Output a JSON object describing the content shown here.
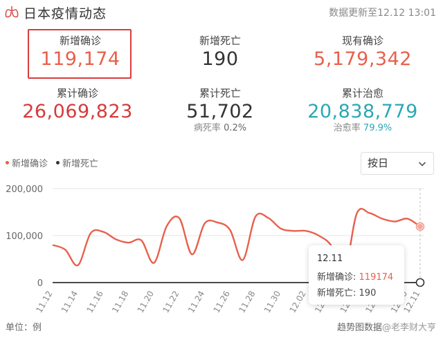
{
  "header": {
    "title": "日本疫情动态",
    "chevron": "›",
    "update_time": "数据更新至12.12 13:01"
  },
  "stats": {
    "new_confirmed": {
      "label": "新增确诊",
      "value": "119,174"
    },
    "new_deaths": {
      "label": "新增死亡",
      "value": "190"
    },
    "current_confirmed": {
      "label": "现有确诊",
      "value": "5,179,342"
    },
    "total_confirmed": {
      "label": "累计确诊",
      "value": "26,069,823"
    },
    "total_deaths": {
      "label": "累计死亡",
      "value": "51,702",
      "sub_label": "病死率",
      "sub_value": "0.2%"
    },
    "total_recovered": {
      "label": "累计治愈",
      "value": "20,838,779",
      "sub_label": "治愈率",
      "sub_value": "79.9%"
    }
  },
  "legend": {
    "confirmed": "新增确诊",
    "deaths": "新增死亡"
  },
  "select": {
    "value": "按日"
  },
  "colors": {
    "confirmed": "#e8604c",
    "deaths": "#333333",
    "highlight": "#d93b3b"
  },
  "chart_data": {
    "type": "line",
    "x": [
      "11.12",
      "11.13",
      "11.14",
      "11.15",
      "11.16",
      "11.17",
      "11.18",
      "11.19",
      "11.20",
      "11.21",
      "11.22",
      "11.23",
      "11.24",
      "11.25",
      "11.26",
      "11.27",
      "11.28",
      "11.29",
      "11.30",
      "12.01",
      "12.02",
      "12.03",
      "12.04",
      "12.05",
      "12.06",
      "12.07",
      "12.08",
      "12.09",
      "12.10",
      "12.11"
    ],
    "x_ticks": [
      "11.12",
      "11.14",
      "11.16",
      "11.18",
      "11.20",
      "11.22",
      "11.24",
      "11.26",
      "11.28",
      "11.30",
      "12.02",
      "12.04",
      "12.06",
      "12.08",
      "12.10",
      "12.11"
    ],
    "series": [
      {
        "name": "新增确诊",
        "values": [
          80000,
          70000,
          37000,
          105000,
          108000,
          92000,
          85000,
          90000,
          42000,
          120000,
          137000,
          60000,
          126000,
          128000,
          112000,
          48000,
          140000,
          138000,
          115000,
          110000,
          110000,
          100000,
          78000,
          20000,
          147000,
          148000,
          136000,
          130000,
          136000,
          119174
        ]
      },
      {
        "name": "新增死亡",
        "values": [
          0,
          0,
          0,
          0,
          0,
          0,
          0,
          0,
          0,
          0,
          0,
          0,
          0,
          0,
          0,
          0,
          0,
          0,
          0,
          0,
          0,
          0,
          0,
          0,
          0,
          0,
          0,
          0,
          0,
          190
        ]
      }
    ],
    "yticks": [
      "0",
      "100,000",
      "200,000"
    ],
    "ylim": [
      0,
      200000
    ]
  },
  "tooltip": {
    "date": "12.11",
    "confirmed_label": "新增确诊:",
    "confirmed_value": "119174",
    "deaths_label": "新增死亡:",
    "deaths_value": "190"
  },
  "footer": {
    "unit": "单位：例",
    "right": "趋势图数据",
    "watermark": "@老李财大亨"
  }
}
